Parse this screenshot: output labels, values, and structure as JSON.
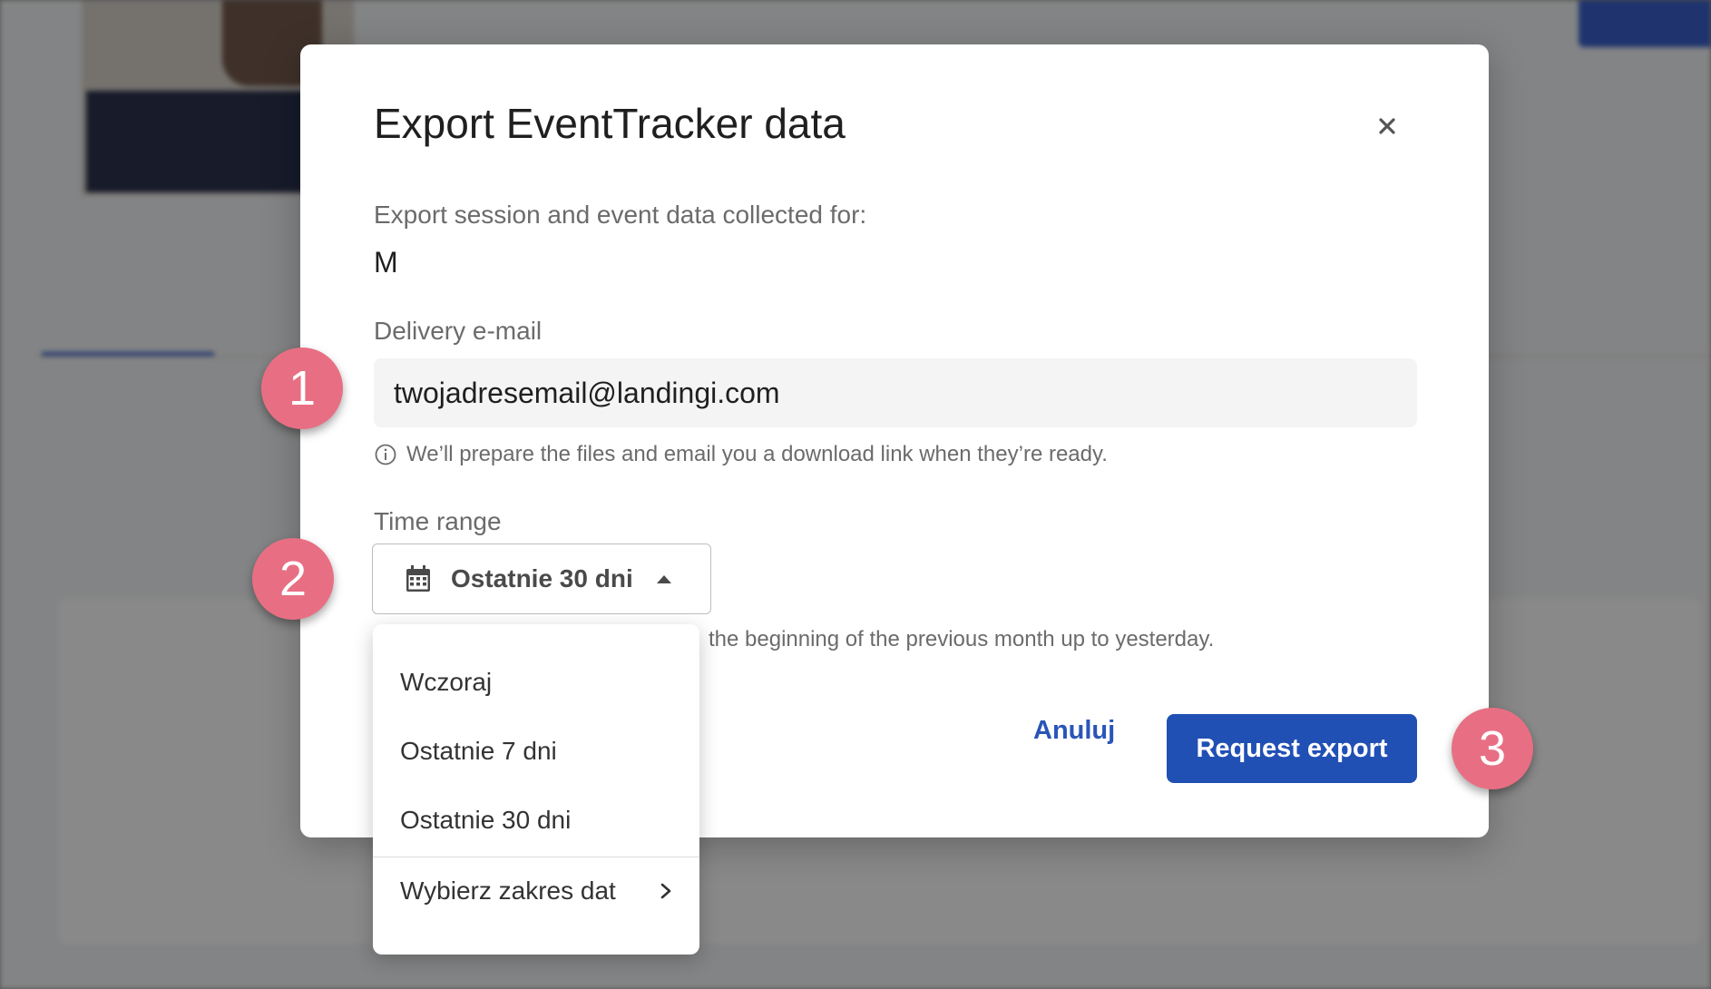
{
  "modal": {
    "title": "Export EventTracker data",
    "intro_label": "Export session and event data collected for:",
    "intro_value": "M",
    "email_label": "Delivery e-mail",
    "email_value": "twojadresemail@landingi.com",
    "hint": "We’ll prepare the files and email you a download link when they’re ready.",
    "time_range_label": "Time range",
    "time_range_selected": "Ostatnie 30 dni",
    "time_range_note": "the beginning of the previous month up to yesterday.",
    "cancel_label": "Anuluj",
    "export_label": "Request export"
  },
  "dropdown": {
    "options": [
      "Wczoraj",
      "Ostatnie 7 dni",
      "Ostatnie 30 dni"
    ],
    "submenu_label": "Wybierz zakres dat"
  },
  "badges": [
    "1",
    "2",
    "3"
  ],
  "colors": {
    "primary": "#2150b5",
    "badge": "#e86f83"
  }
}
